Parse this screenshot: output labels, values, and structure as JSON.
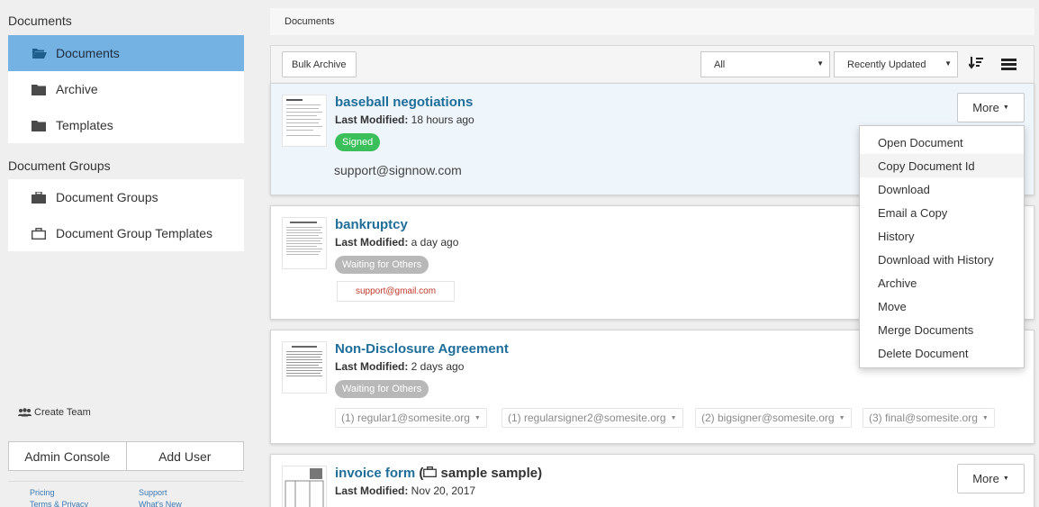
{
  "sidebar": {
    "documents_heading": "Documents",
    "documents_items": [
      {
        "label": "Documents",
        "icon": "folder-open-icon",
        "active": true
      },
      {
        "label": "Archive",
        "icon": "folder-icon",
        "active": false
      },
      {
        "label": "Templates",
        "icon": "folder-icon",
        "active": false
      }
    ],
    "groups_heading": "Document Groups",
    "groups_items": [
      {
        "label": "Document Groups",
        "icon": "briefcase-icon"
      },
      {
        "label": "Document Group Templates",
        "icon": "briefcase-outline-icon"
      }
    ],
    "create_team": "Create Team",
    "admin_console": "Admin Console",
    "add_user": "Add User",
    "footer_links": {
      "pricing": "Pricing",
      "support": "Support",
      "terms": "Terms & Privacy",
      "whats_new": "What's New"
    }
  },
  "breadcrumb": "Documents",
  "toolbar": {
    "bulk_archive": "Bulk Archive",
    "filter_value": "All",
    "sort_value": "Recently Updated",
    "sort_icon": "sort-descending-icon",
    "view_icon": "list-view-icon"
  },
  "documents": [
    {
      "title": "baseball negotiations",
      "modified_label": "Last Modified:",
      "modified": "18 hours ago",
      "status": "Signed",
      "signer": "support@signnow.com",
      "more": "More"
    },
    {
      "title": "bankruptcy",
      "modified_label": "Last Modified:",
      "modified": "a day ago",
      "status": "Waiting for Others",
      "signer": "support@gmail.com"
    },
    {
      "title": "Non-Disclosure Agreement",
      "modified_label": "Last Modified:",
      "modified": "2 days ago",
      "status": "Waiting for Others",
      "signers": [
        "(1) regular1@somesite.org",
        "(1) regularsigner2@somesite.org",
        "(2) bigsigner@somesite.org",
        "(3) final@somesite.org"
      ]
    },
    {
      "title": "invoice form",
      "group_open": "(",
      "group_name": "sample sample)",
      "modified_label": "Last Modified:",
      "modified": "Nov 20, 2017",
      "more": "More"
    }
  ],
  "more_menu": [
    "Open Document",
    "Copy Document Id",
    "Download",
    "Email a Copy",
    "History",
    "Download with History",
    "Archive",
    "Move",
    "Merge Documents",
    "Delete Document"
  ],
  "colors": {
    "accent": "#73b2e3",
    "link": "#1f6e9a",
    "signed": "#3bbf5b",
    "waiting": "#b8b8b8"
  }
}
